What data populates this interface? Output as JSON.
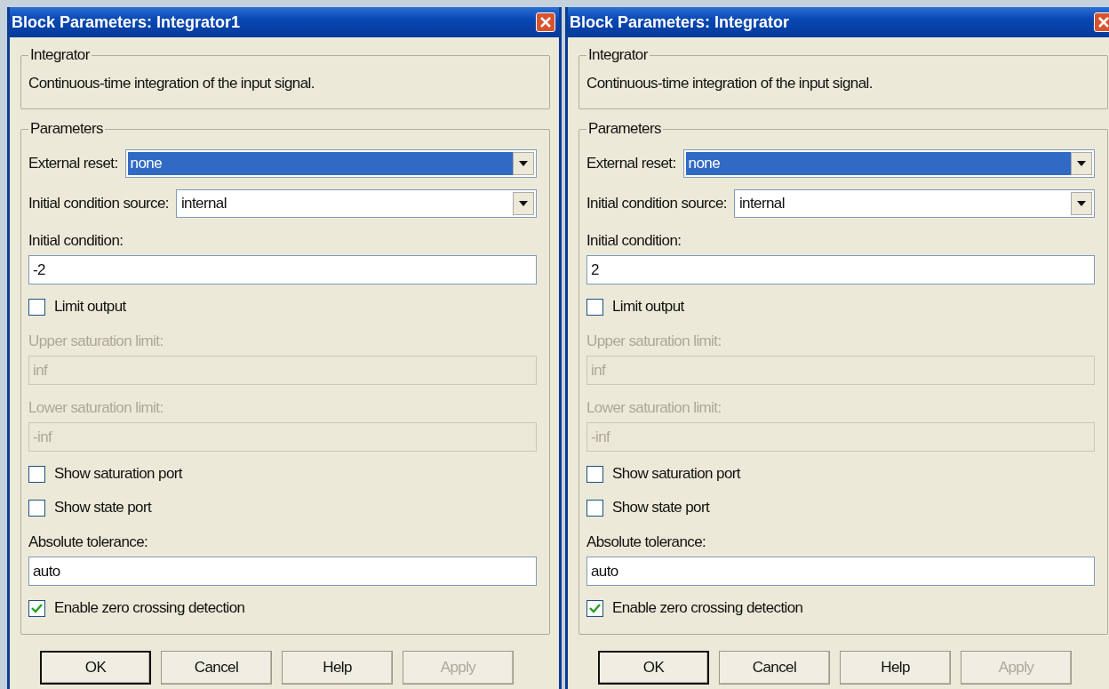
{
  "windows": [
    {
      "title": "Block Parameters: Integrator1",
      "description": {
        "legend": "Integrator",
        "text": "Continuous-time integration of the input signal."
      },
      "parameters": {
        "legend": "Parameters",
        "rows": [
          {
            "kind": "dropdown",
            "label": "External reset:",
            "value": "none",
            "focused": true
          },
          {
            "kind": "dropdown",
            "label": "Initial condition source:",
            "value": "internal",
            "focused": false
          },
          {
            "kind": "field",
            "label": "Initial condition:",
            "value": "-2",
            "disabled": false
          },
          {
            "kind": "checkbox",
            "label": "Limit output",
            "checked": false
          },
          {
            "kind": "field",
            "label": "Upper saturation limit:",
            "value": "inf",
            "disabled": true
          },
          {
            "kind": "field",
            "label": "Lower saturation limit:",
            "value": "-inf",
            "disabled": true
          },
          {
            "kind": "checkbox",
            "label": "Show saturation port",
            "checked": false
          },
          {
            "kind": "checkbox",
            "label": "Show state port",
            "checked": false
          },
          {
            "kind": "field",
            "label": "Absolute tolerance:",
            "value": "auto",
            "disabled": false
          },
          {
            "kind": "checkbox",
            "label": "Enable zero crossing detection",
            "checked": true
          }
        ]
      },
      "buttons": [
        {
          "label": "OK",
          "default": true,
          "disabled": false
        },
        {
          "label": "Cancel",
          "default": false,
          "disabled": false
        },
        {
          "label": "Help",
          "default": false,
          "disabled": false
        },
        {
          "label": "Apply",
          "default": false,
          "disabled": true
        }
      ]
    },
    {
      "title": "Block Parameters: Integrator",
      "description": {
        "legend": "Integrator",
        "text": "Continuous-time integration of the input signal."
      },
      "parameters": {
        "legend": "Parameters",
        "rows": [
          {
            "kind": "dropdown",
            "label": "External reset:",
            "value": "none",
            "focused": true
          },
          {
            "kind": "dropdown",
            "label": "Initial condition source:",
            "value": "internal",
            "focused": false
          },
          {
            "kind": "field",
            "label": "Initial condition:",
            "value": "2",
            "disabled": false
          },
          {
            "kind": "checkbox",
            "label": "Limit output",
            "checked": false
          },
          {
            "kind": "field",
            "label": "Upper saturation limit:",
            "value": "inf",
            "disabled": true
          },
          {
            "kind": "field",
            "label": "Lower saturation limit:",
            "value": "-inf",
            "disabled": true
          },
          {
            "kind": "checkbox",
            "label": "Show saturation port",
            "checked": false
          },
          {
            "kind": "checkbox",
            "label": "Show state port",
            "checked": false
          },
          {
            "kind": "field",
            "label": "Absolute tolerance:",
            "value": "auto",
            "disabled": false
          },
          {
            "kind": "checkbox",
            "label": "Enable zero crossing detection",
            "checked": true
          }
        ]
      },
      "buttons": [
        {
          "label": "OK",
          "default": true,
          "disabled": false
        },
        {
          "label": "Cancel",
          "default": false,
          "disabled": false
        },
        {
          "label": "Help",
          "default": false,
          "disabled": false
        },
        {
          "label": "Apply",
          "default": false,
          "disabled": true
        }
      ]
    }
  ]
}
